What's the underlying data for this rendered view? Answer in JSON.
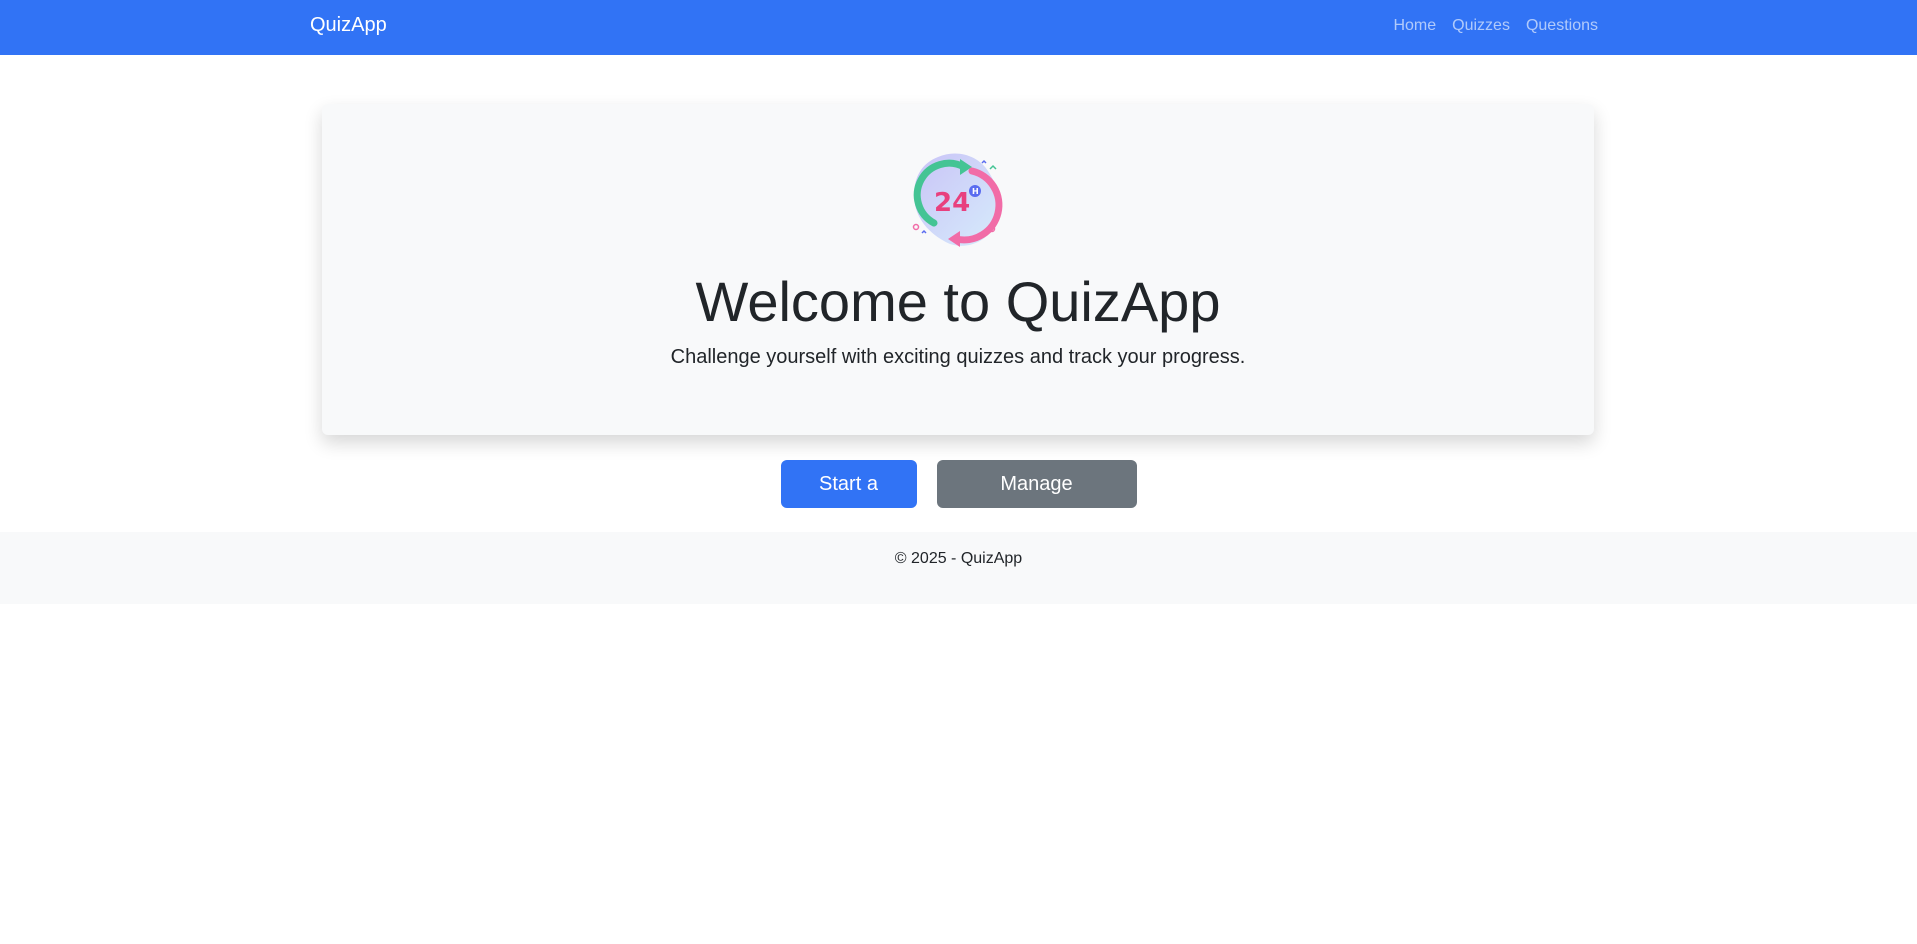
{
  "colors": {
    "primary": "#3173f5",
    "secondary": "#6c757d",
    "light": "#f8f9fa"
  },
  "navbar": {
    "brand": "QuizApp",
    "links": [
      "Home",
      "Quizzes",
      "Questions"
    ]
  },
  "hero": {
    "logo_icon": "24h-cycle-icon",
    "title": "Welcome to QuizApp",
    "lead": "Challenge yourself with exciting quizzes and track your progress."
  },
  "actions": {
    "start_label": "Start a Quiz",
    "manage_label": "Manage Questions"
  },
  "footer": {
    "text": "© 2025 - QuizApp"
  }
}
